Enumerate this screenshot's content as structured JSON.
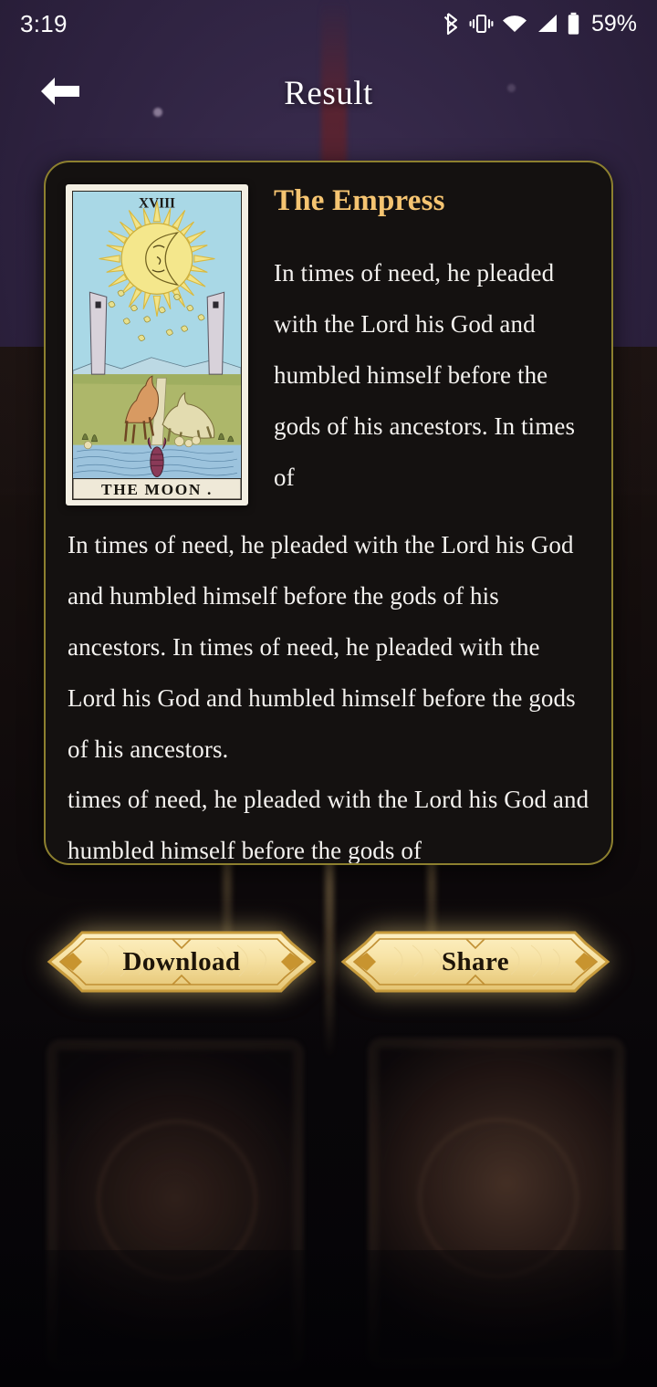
{
  "status_bar": {
    "time": "3:19",
    "battery_percent": "59%",
    "icons": [
      "bluetooth-icon",
      "vibrate-icon",
      "wifi-icon",
      "cellular-signal-icon",
      "battery-icon"
    ]
  },
  "header": {
    "title": "Result",
    "back_icon": "arrow-left-icon"
  },
  "result": {
    "card_name": "The Empress",
    "card_image": {
      "name": "the-moon-tarot-card",
      "numeral": "XVIII",
      "caption": "THE MOON ."
    },
    "description": "In times of need, he pleaded with the Lord his God and humbled himself before the gods of his ancestors. In times of",
    "body_paragraph": "In times of need, he pleaded with the Lord his God and humbled himself before the gods of his ancestors. In times of need, he pleaded with the Lord his God and humbled himself before the gods of his ancestors.",
    "body_paragraph_2": "times of need, he pleaded with the Lord his God and humbled himself before the gods of"
  },
  "actions": {
    "download_label": "Download",
    "share_label": "Share"
  },
  "colors": {
    "panel_border": "#8d802f",
    "panel_background": "#141110",
    "card_title_gold": "#f5c471",
    "body_text": "#f4f2ef",
    "button_gold_light": "#fbeab4",
    "button_gold_dark": "#c79b3c",
    "button_text": "#1d1408",
    "header_background_purple": "#2d223e"
  }
}
